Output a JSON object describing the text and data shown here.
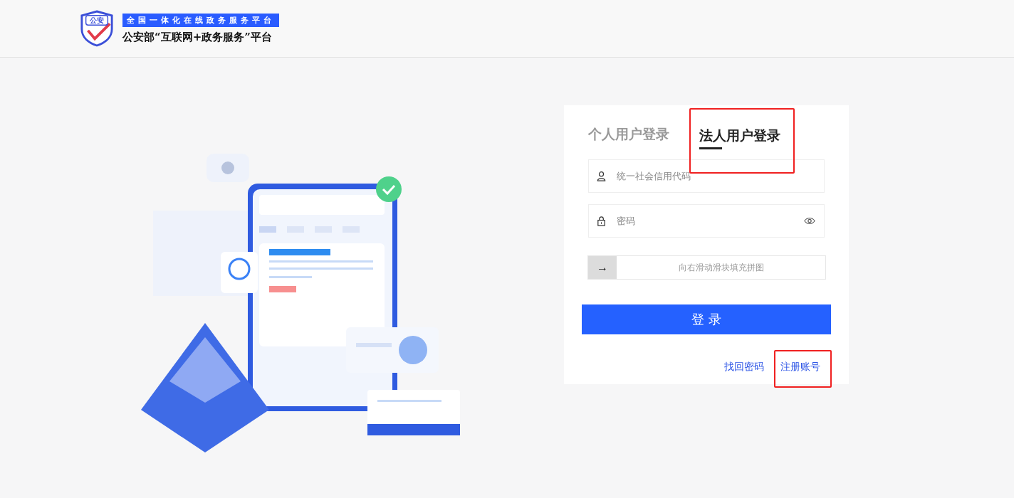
{
  "header": {
    "logo_badge": "公安",
    "tagline": "全国一体化在线政务服务平台",
    "title": "公安部“互联网+政务服务”平台"
  },
  "login": {
    "tabs": [
      {
        "label": "个人用户登录",
        "selected": false,
        "annotated": false
      },
      {
        "label": "法人用户登录",
        "selected": true,
        "annotated": true
      }
    ],
    "fields": [
      {
        "kind": "user",
        "placeholder": "统一社会信用代码"
      },
      {
        "kind": "password",
        "placeholder": "密码"
      }
    ],
    "slider": {
      "handle": "→",
      "hint": "向右滑动滑块填充拼图"
    },
    "submit": "登 录",
    "links": [
      {
        "label": "找回密码",
        "annotated": false
      },
      {
        "label": "注册账号",
        "annotated": true
      }
    ]
  }
}
